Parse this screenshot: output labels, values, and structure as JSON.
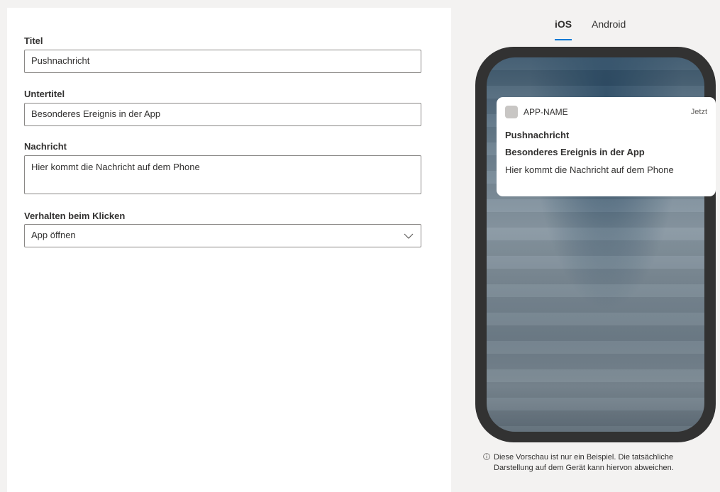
{
  "form": {
    "title_label": "Titel",
    "title_value": "Pushnachricht",
    "subtitle_label": "Untertitel",
    "subtitle_value": "Besonderes Ereignis in der App",
    "message_label": "Nachricht",
    "message_value": "Hier kommt die Nachricht auf dem Phone",
    "click_behavior_label": "Verhalten beim Klicken",
    "click_behavior_value": "App öffnen"
  },
  "preview": {
    "tabs": [
      {
        "label": "iOS",
        "selected": true
      },
      {
        "label": "Android",
        "selected": false
      }
    ],
    "notification": {
      "app_name": "APP-NAME",
      "time": "Jetzt",
      "title": "Pushnachricht",
      "subtitle": "Besonderes Ereignis in der App",
      "body": "Hier kommt die Nachricht auf dem Phone"
    },
    "disclaimer": "Diese Vorschau ist nur ein Beispiel. Die tatsächliche Darstellung auf dem Gerät kann hiervon abweichen."
  },
  "colors": {
    "accent": "#0078d4",
    "phone_frame": "#323232"
  },
  "icons": [
    "chevron-down-icon",
    "info-icon"
  ]
}
